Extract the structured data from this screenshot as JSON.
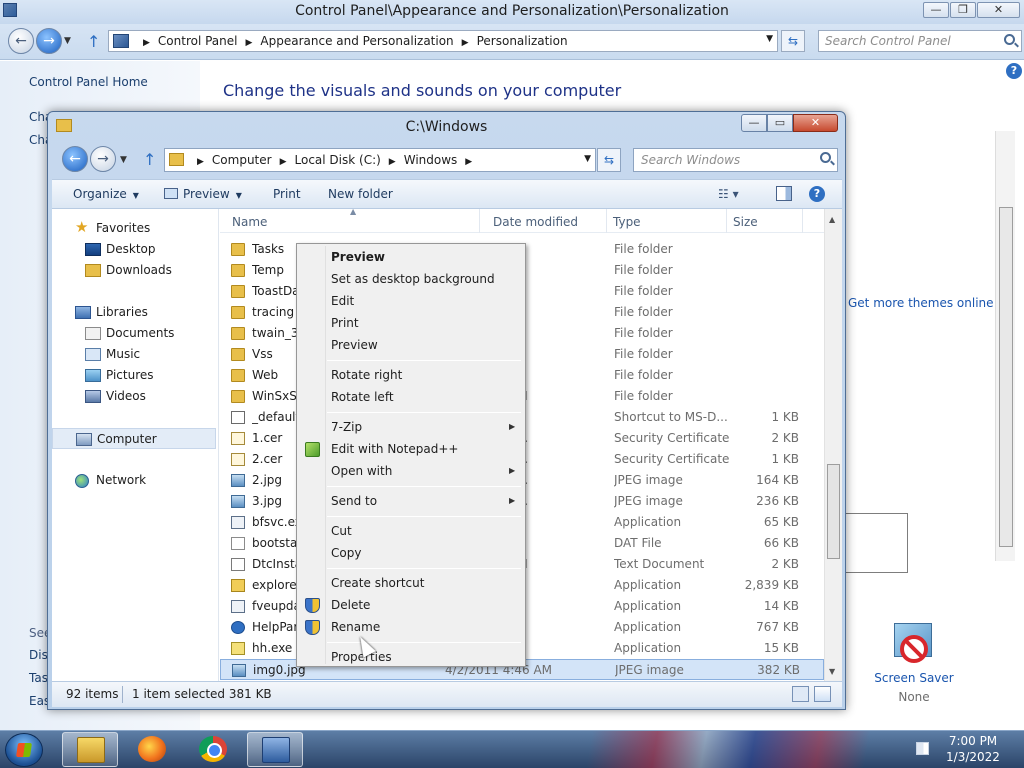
{
  "control_panel": {
    "title": "Control Panel\\Appearance and Personalization\\Personalization",
    "caption_buttons": {
      "minimize": "—",
      "maximize": "❐",
      "close": "✕"
    },
    "breadcrumbs": [
      "Control Panel",
      "Appearance and Personalization",
      "Personalization"
    ],
    "search_placeholder": "Search Control Panel",
    "sidebar": {
      "home_link": "Control Panel Home",
      "fragments": [
        "Cha",
        "Cha"
      ],
      "see_also": "See",
      "see_also_fragments": [
        "Disp",
        "Task",
        "Ease"
      ]
    },
    "heading": "Change the visuals and sounds on your computer",
    "themes_link": "Get more themes online",
    "screen_saver": {
      "label": "Screen Saver",
      "value": "None"
    }
  },
  "explorer": {
    "title": "C:\\Windows",
    "caption_buttons": {
      "minimize": "—",
      "maximize": "▭",
      "close": "✕"
    },
    "breadcrumbs": [
      "Computer",
      "Local Disk (C:)",
      "Windows"
    ],
    "search_placeholder": "Search Windows",
    "toolbar": {
      "organize": "Organize",
      "preview": "Preview",
      "print": "Print",
      "new_folder": "New folder",
      "help": "?"
    },
    "nav_pane": {
      "favorites": "Favorites",
      "desktop": "Desktop",
      "downloads": "Downloads",
      "libraries": "Libraries",
      "documents": "Documents",
      "music": "Music",
      "pictures": "Pictures",
      "videos": "Videos",
      "computer": "Computer",
      "network": "Network"
    },
    "columns": {
      "name": "Name",
      "date": "Date modified",
      "type": "Type",
      "size": "Size"
    },
    "files": [
      {
        "name": "Tasks",
        "date": "11 10:03 PM",
        "type": "File folder",
        "size": ""
      },
      {
        "name": "Temp",
        "date": "22 6:59 PM",
        "type": "File folder",
        "size": ""
      },
      {
        "name": "ToastDa",
        "date": "11 10:56 PM",
        "type": "File folder",
        "size": ""
      },
      {
        "name": "tracing",
        "date": "11 10:56 PM",
        "type": "File folder",
        "size": ""
      },
      {
        "name": "twain_32",
        "date": "11 10:56 PM",
        "type": "File folder",
        "size": ""
      },
      {
        "name": "Vss",
        "date": "11 10:56 PM",
        "type": "File folder",
        "size": ""
      },
      {
        "name": "Web",
        "date": "11 10:56 PM",
        "type": "File folder",
        "size": ""
      },
      {
        "name": "WinSxS",
        "date": "2021 6:42 AM",
        "type": "File folder",
        "size": ""
      },
      {
        "name": "_default",
        "date": "11 4:47 AM",
        "type": "Shortcut to MS-D...",
        "size": "1 KB"
      },
      {
        "name": "1.cer",
        "date": "2021 11:04 ...",
        "type": "Security Certificate",
        "size": "2 KB"
      },
      {
        "name": "2.cer",
        "date": "2021 11:08 ...",
        "type": "Security Certificate",
        "size": "1 KB"
      },
      {
        "name": "2.jpg",
        "date": "2021 11:21 ...",
        "type": "JPEG image",
        "size": "164 KB"
      },
      {
        "name": "3.jpg",
        "date": "2021 11:21 ...",
        "type": "JPEG image",
        "size": "236 KB"
      },
      {
        "name": "bfsvc.ex",
        "date": "11 12:12 AM",
        "type": "Application",
        "size": "65 KB"
      },
      {
        "name": "bootstat",
        "date": "22 6:57 PM",
        "type": "DAT File",
        "size": "66 KB"
      },
      {
        "name": "DtcInsta",
        "date": "2021 6:40 AM",
        "type": "Text Document",
        "size": "2 KB"
      },
      {
        "name": "explorer",
        "date": "11 12:49 AM",
        "type": "Application",
        "size": "2,839 KB"
      },
      {
        "name": "fveupda",
        "date": "11 12:12 AM",
        "type": "Application",
        "size": "14 KB"
      },
      {
        "name": "HelpPar",
        "date": "11 12:12 AM",
        "type": "Application",
        "size": "767 KB"
      },
      {
        "name": "hh.exe",
        "date": "11 12:12 AM",
        "type": "Application",
        "size": "15 KB"
      },
      {
        "name": "img0.jpg",
        "date": "4/2/2011 4:46 AM",
        "type": "JPEG image",
        "size": "382 KB"
      }
    ],
    "status": {
      "count": "92 items",
      "selected": "1 item selected  381 KB"
    }
  },
  "context_menu": {
    "preview_default": "Preview",
    "set_background": "Set as desktop background",
    "edit": "Edit",
    "print": "Print",
    "preview": "Preview",
    "rotate_right": "Rotate right",
    "rotate_left": "Rotate left",
    "seven_zip": "7-Zip",
    "edit_notepad": "Edit with Notepad++",
    "open_with": "Open with",
    "send_to": "Send to",
    "cut": "Cut",
    "copy": "Copy",
    "create_shortcut": "Create shortcut",
    "delete": "Delete",
    "rename": "Rename",
    "properties": "Properties"
  },
  "taskbar": {
    "time": "7:00 PM",
    "date": "1/3/2022"
  },
  "colors": {
    "accent": "#2f6fc2",
    "selection": "#d3e4f8",
    "link": "#1a55ae",
    "heading": "#1e3287"
  }
}
